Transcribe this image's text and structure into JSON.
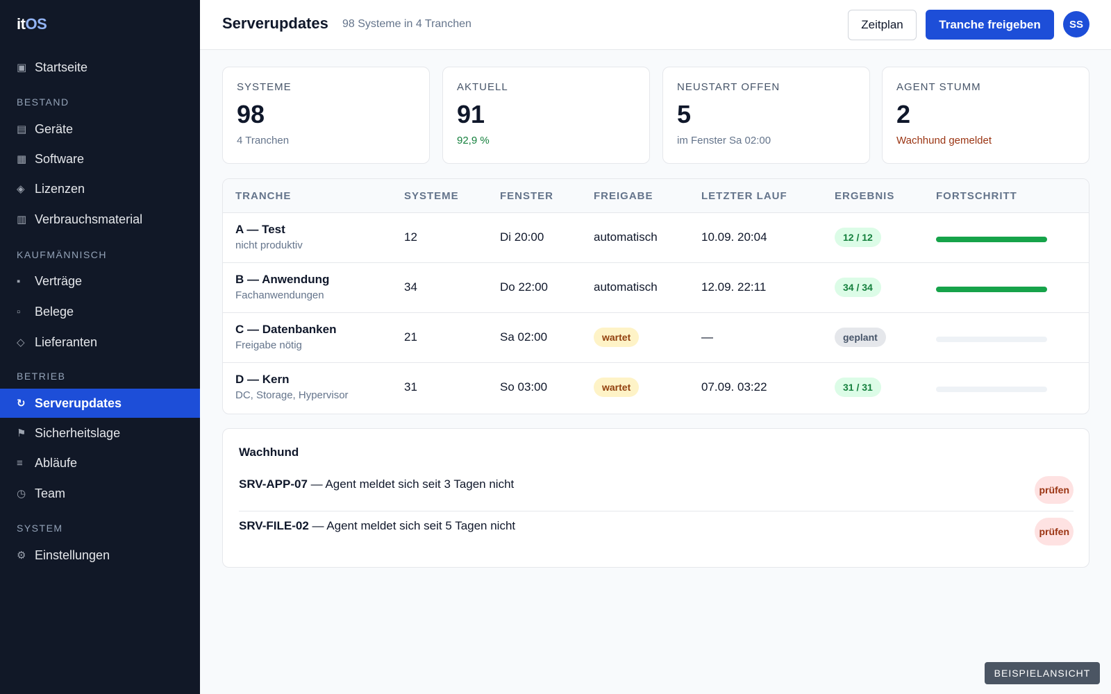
{
  "app": {
    "logo_part1": "it",
    "logo_part2": "OS"
  },
  "sidebar": {
    "home": {
      "label": "Startseite",
      "icon": "dashboard-icon"
    },
    "sections": [
      {
        "title": "BESTAND",
        "items": [
          {
            "label": "Geräte",
            "icon": "devices-icon"
          },
          {
            "label": "Software",
            "icon": "software-icon"
          },
          {
            "label": "Lizenzen",
            "icon": "license-icon"
          },
          {
            "label": "Verbrauchsmaterial",
            "icon": "supplies-icon"
          }
        ]
      },
      {
        "title": "KAUFMÄNNISCH",
        "items": [
          {
            "label": "Verträge",
            "icon": "contract-icon"
          },
          {
            "label": "Belege",
            "icon": "receipt-icon"
          },
          {
            "label": "Lieferanten",
            "icon": "supplier-icon"
          }
        ]
      },
      {
        "title": "BETRIEB",
        "items": [
          {
            "label": "Serverupdates",
            "icon": "refresh-icon",
            "active": true
          },
          {
            "label": "Sicherheitslage",
            "icon": "flag-icon"
          },
          {
            "label": "Abläufe",
            "icon": "list-icon"
          },
          {
            "label": "Team",
            "icon": "clock-icon"
          }
        ]
      },
      {
        "title": "SYSTEM",
        "items": [
          {
            "label": "Einstellungen",
            "icon": "gear-icon"
          }
        ]
      }
    ]
  },
  "header": {
    "title": "Serverupdates",
    "subtitle": "98 Systeme in 4 Tranchen",
    "schedule_button": "Zeitplan",
    "release_button": "Tranche freigeben",
    "avatar_initials": "SS"
  },
  "kpis": [
    {
      "label": "SYSTEME",
      "value": "98",
      "note": "4 Tranchen",
      "tone": "muted"
    },
    {
      "label": "AKTUELL",
      "value": "91",
      "note": "92,9 %",
      "tone": "green"
    },
    {
      "label": "NEUSTART OFFEN",
      "value": "5",
      "note": "im Fenster Sa 02:00",
      "tone": "muted"
    },
    {
      "label": "AGENT STUMM",
      "value": "2",
      "note": "Wachhund gemeldet",
      "tone": "brown"
    }
  ],
  "table": {
    "headers": [
      "TRANCHE",
      "SYSTEME",
      "FENSTER",
      "FREIGABE",
      "LETZTER LAUF",
      "ERGEBNIS",
      "FORTSCHRITT"
    ],
    "rows": [
      {
        "name": "A — Test",
        "sub": "nicht produktiv",
        "systems": "12",
        "window": "Di 20:00",
        "release": "automatisch",
        "release_pill": false,
        "last_run": "10.09. 20:04",
        "result": "12 / 12",
        "result_tone": "ok",
        "progress": 1.0
      },
      {
        "name": "B — Anwendung",
        "sub": "Fachanwendungen",
        "systems": "34",
        "window": "Do 22:00",
        "release": "automatisch",
        "release_pill": false,
        "last_run": "12.09. 22:11",
        "result": "34 / 34",
        "result_tone": "ok",
        "progress": 1.0
      },
      {
        "name": "C — Datenbanken",
        "sub": "Freigabe nötig",
        "systems": "21",
        "window": "Sa 02:00",
        "release": "wartet",
        "release_pill": true,
        "last_run": "—",
        "result": "geplant",
        "result_tone": "plan",
        "progress": 0.0
      },
      {
        "name": "D — Kern",
        "sub": "DC, Storage, Hypervisor",
        "systems": "31",
        "window": "So 03:00",
        "release": "wartet",
        "release_pill": true,
        "last_run": "07.09. 03:22",
        "result": "31 / 31",
        "result_tone": "ok",
        "progress": 0.0
      }
    ]
  },
  "watchdog": {
    "title": "Wachhund",
    "items": [
      {
        "host": "SRV-APP-07",
        "text": " — Agent meldet sich seit 3 Tagen nicht",
        "action": "prüfen"
      },
      {
        "host": "SRV-FILE-02",
        "text": " — Agent meldet sich seit 5 Tagen nicht",
        "action": "prüfen"
      }
    ]
  },
  "footer_badge": "BEISPIELANSICHT",
  "colors": {
    "accent": "#1d4ed8",
    "sidebar_bg": "#111827",
    "success": "#16a34a",
    "warning_bg": "#fef3c7",
    "danger_bg": "#fee2e2"
  }
}
